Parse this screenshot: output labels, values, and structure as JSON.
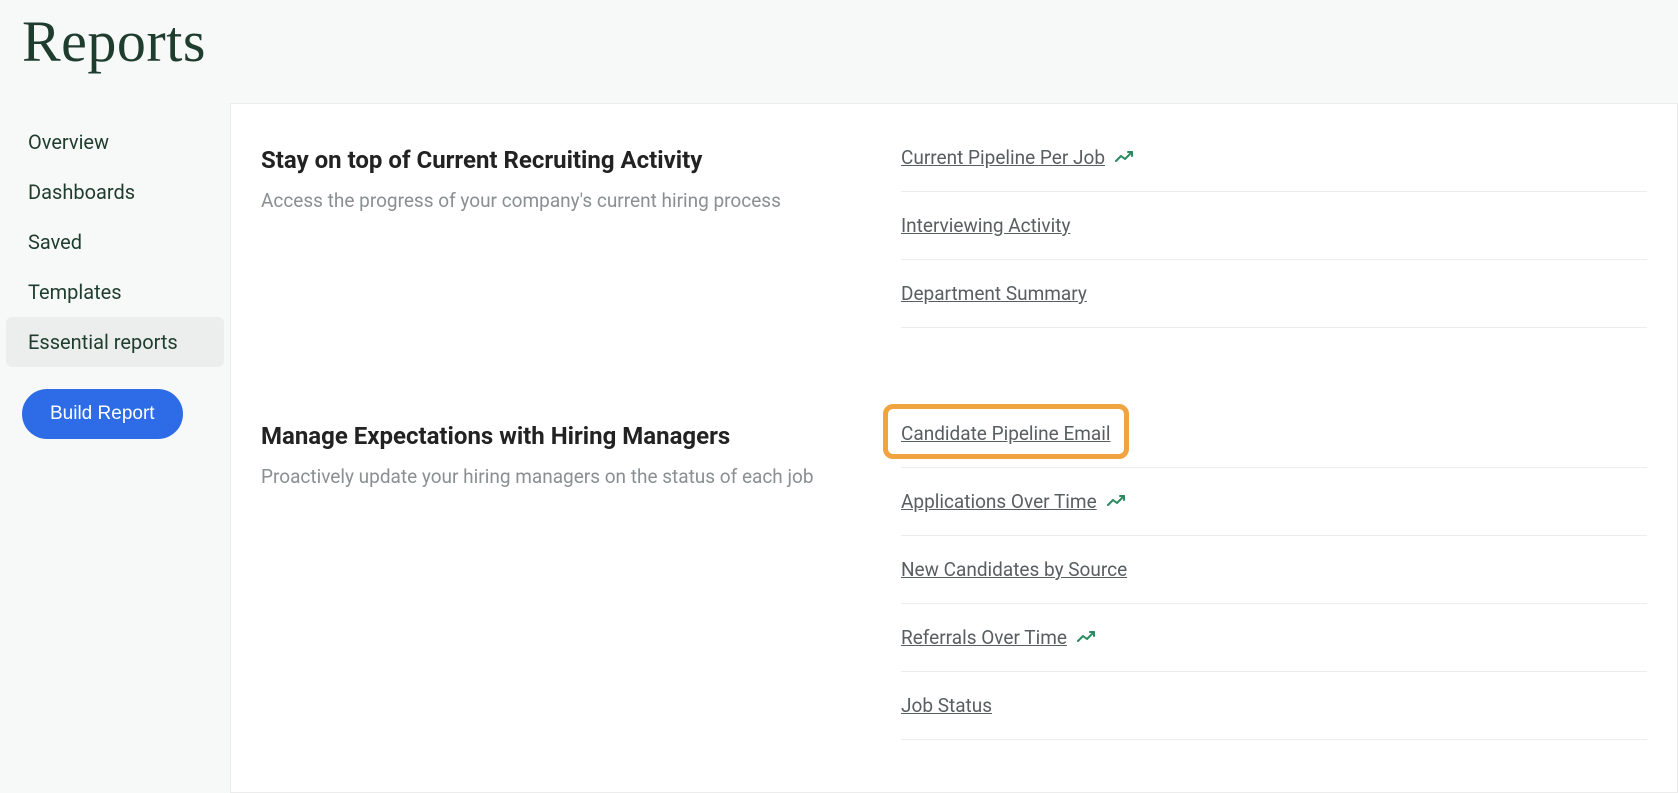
{
  "page_title": "Reports",
  "sidebar": {
    "items": [
      {
        "label": "Overview",
        "active": false
      },
      {
        "label": "Dashboards",
        "active": false
      },
      {
        "label": "Saved",
        "active": false
      },
      {
        "label": "Templates",
        "active": false
      },
      {
        "label": "Essential reports",
        "active": true
      }
    ],
    "build_report_label": "Build Report"
  },
  "sections": [
    {
      "title": "Stay on top of Current Recruiting Activity",
      "description": "Access the progress of your company's current hiring process",
      "links": [
        {
          "label": "Current Pipeline Per Job",
          "has_chart_icon": true,
          "highlighted": false
        },
        {
          "label": "Interviewing Activity",
          "has_chart_icon": false,
          "highlighted": false
        },
        {
          "label": "Department Summary",
          "has_chart_icon": false,
          "highlighted": false
        }
      ]
    },
    {
      "title": "Manage Expectations with Hiring Managers",
      "description": "Proactively update your hiring managers on the status of each job",
      "links": [
        {
          "label": "Candidate Pipeline Email",
          "has_chart_icon": false,
          "highlighted": true
        },
        {
          "label": "Applications Over Time",
          "has_chart_icon": true,
          "highlighted": false
        },
        {
          "label": "New Candidates by Source",
          "has_chart_icon": false,
          "highlighted": false
        },
        {
          "label": "Referrals Over Time",
          "has_chart_icon": true,
          "highlighted": false
        },
        {
          "label": "Job Status",
          "has_chart_icon": false,
          "highlighted": false
        }
      ]
    }
  ],
  "colors": {
    "accent_green": "#2a8a5f",
    "highlight_orange": "#f0a33f",
    "button_blue": "#2e6be6"
  }
}
